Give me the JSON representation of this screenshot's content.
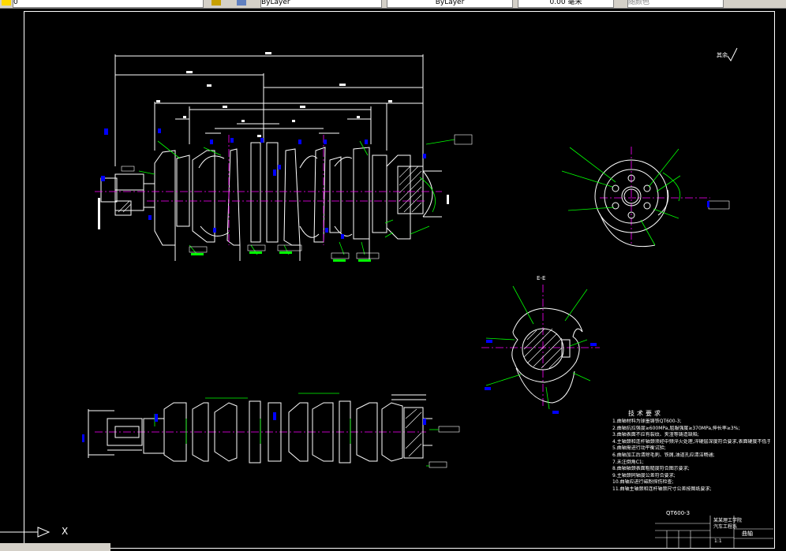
{
  "toolbar": {
    "layer_control": "0",
    "color_control": "ByLayer",
    "linetype_control": "ByLayer",
    "lineweight_control": "0.00 毫米",
    "plotstyle_control": "随颜色"
  },
  "drawing": {
    "finish_symbol_label": "其余",
    "section_label": "E-E",
    "tech_req_title": "技术要求",
    "tech_req_lines": [
      "1.曲轴材料为球墨铸铁QT600-3;",
      "2.曲轴抗拉强度≥600MPa,屈服强度≥370MPa,伸长率≥3%;",
      "3.曲轴表面不应有裂纹、夹渣等铸造缺陷;",
      "4.主轴颈和连杆轴颈须经中频淬火处理,淬硬层深度符合要求,表面硬度不低于规定值;",
      "5.曲轴需进行动平衡试验;",
      "6.曲轴加工后清除毛刺、铁屑,油道孔应清洁畅通;",
      "7.未注倒角C1;",
      "8.曲轴轴颈表面粗糙度符合图示要求;",
      "9.主轴颈同轴度公差符合要求;",
      "10.曲轴应进行磁粉探伤检查;",
      "11.曲轴主轴颈和连杆轴颈尺寸公差按图纸要求;"
    ],
    "title_block": {
      "drawing_number": "QT600-3",
      "part_name": "曲轴",
      "org_line1": "某某理工学院",
      "org_line2": "汽车工程系",
      "scale_label": "1:1"
    },
    "ucs_label": "X"
  },
  "colors": {
    "background": "#000000",
    "line_white": "#ffffff",
    "dim_green": "#00ff00",
    "centerline_magenta": "#ff00ff",
    "note_blue": "#0000ff",
    "toolbar_gray": "#d4d0c8"
  }
}
